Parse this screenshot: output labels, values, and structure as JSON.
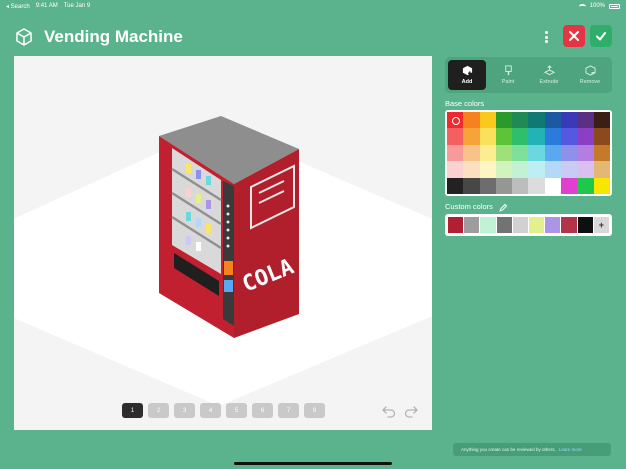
{
  "status": {
    "carrier": "◂ Search",
    "time": "9:41 AM",
    "date": "Tue Jan 9",
    "battery": "100%"
  },
  "header": {
    "title": "Vending Machine"
  },
  "tools": [
    {
      "label": "Add",
      "icon": "add-block-icon",
      "active": true
    },
    {
      "label": "Paint",
      "icon": "paint-icon",
      "active": false
    },
    {
      "label": "Extrude",
      "icon": "extrude-icon",
      "active": false
    },
    {
      "label": "Remove",
      "icon": "remove-icon",
      "active": false
    }
  ],
  "base_colors_label": "Base colors",
  "custom_colors_label": "Custom colors",
  "base_colors": [
    "#ee2a2e",
    "#f5811f",
    "#fbc81d",
    "#2a9a2a",
    "#1f8a56",
    "#0f7a74",
    "#1b5aa3",
    "#3a3ab8",
    "#5a2f86",
    "#3b1f14",
    "#f46060",
    "#f7a33a",
    "#fbe05b",
    "#5dc43a",
    "#2fbe6c",
    "#22b3b7",
    "#2b7bdc",
    "#5558e0",
    "#8a3fc4",
    "#8a4a1c",
    "#f79a9a",
    "#f8c28a",
    "#fcee90",
    "#9fe07a",
    "#7ee09a",
    "#6ad8de",
    "#5aa8f0",
    "#8f90ec",
    "#b27ee2",
    "#c57a2a",
    "#fbd0d0",
    "#fbe0c0",
    "#fdf5c4",
    "#d2f2bf",
    "#c3f2d2",
    "#bdeef1",
    "#b5d7fa",
    "#c9cbf6",
    "#dac0f1",
    "#e3b877",
    "#222222",
    "#474747",
    "#6d6d6d",
    "#969696",
    "#bdbdbd",
    "#dcdcdc",
    "#ffffff",
    "#e03fd0",
    "#1ec94a",
    "#f7e600"
  ],
  "custom_colors": [
    "#b11f35",
    "#9d9d9d",
    "#c0f2d6",
    "#737373",
    "#d1d1d1",
    "#e3f18c",
    "#ad94e6",
    "#b23448",
    "#0f0f0f"
  ],
  "frames": [
    "1",
    "2",
    "3",
    "4",
    "5",
    "6",
    "7",
    "8"
  ],
  "sign": {
    "text": "COLA"
  },
  "toast": {
    "text": "Anything you create can be reviewed by others.",
    "link": "Learn more"
  }
}
